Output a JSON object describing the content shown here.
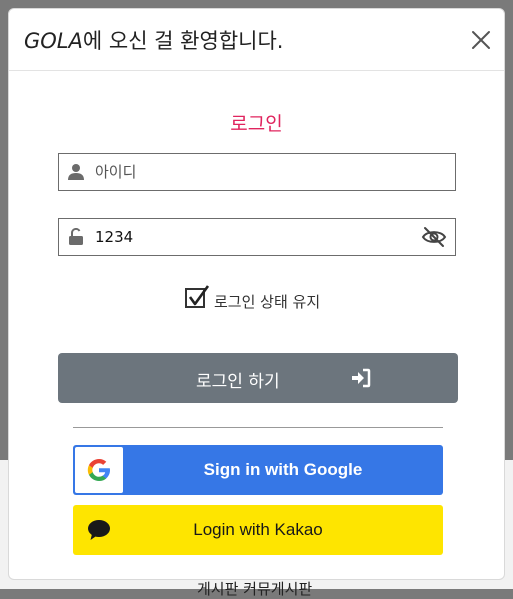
{
  "backdrop": {
    "text": "게시판 커뮤게시판"
  },
  "modal": {
    "title_brand": "GOLA",
    "title_rest": "에 오신 걸 환영합니다.",
    "close_icon": "close-icon"
  },
  "login": {
    "heading": "로그인",
    "id_field": {
      "value": "",
      "placeholder": "아이디",
      "icon": "user-icon"
    },
    "password_field": {
      "value": "1234",
      "placeholder": "",
      "icon": "unlock-icon",
      "toggle_icon": "eye-slash-icon"
    },
    "remember": {
      "label": "로그인 상태 유지",
      "checked": true
    },
    "submit_label": "로그인 하기",
    "submit_icon": "sign-in-icon"
  },
  "social": {
    "google_label": "Sign in with Google",
    "kakao_label": "Login with Kakao"
  },
  "colors": {
    "heading": "#e0245e",
    "login_button": "#6c757d",
    "google": "#3677e6",
    "kakao": "#fee500"
  }
}
